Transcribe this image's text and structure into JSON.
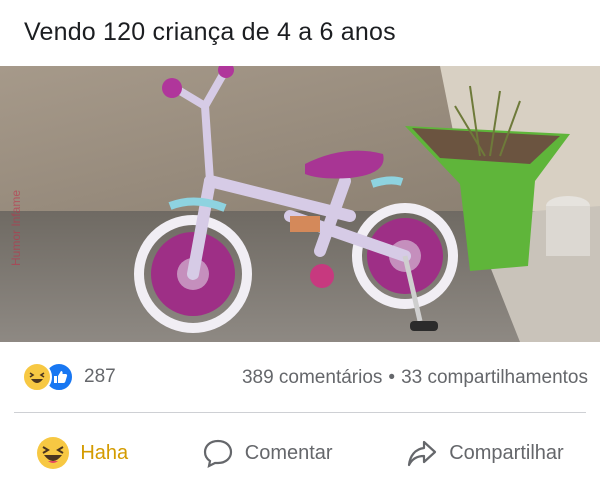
{
  "post": {
    "text": "Vendo 120 criança de 4 a 6 anos",
    "watermark": "Humor Infame"
  },
  "photo": {
    "description_icon": "photo-bicycle"
  },
  "reactions": {
    "count": "287",
    "types": [
      "haha-icon",
      "like-icon"
    ]
  },
  "stats": {
    "comments": "389 comentários",
    "separator": "•",
    "shares": "33 compartilhamentos"
  },
  "actions": {
    "haha_label": "Haha",
    "comment_label": "Comentar",
    "share_label": "Compartilhar"
  },
  "colors": {
    "haha": "#d49b00",
    "like": "#1877f2",
    "text_secondary": "#65676b"
  }
}
